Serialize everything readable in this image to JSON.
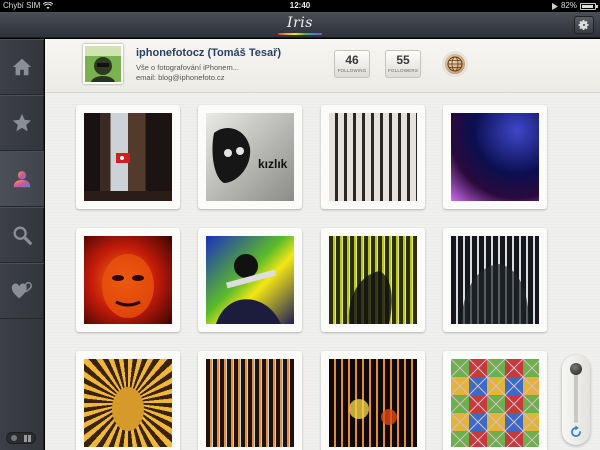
{
  "status_bar": {
    "carrier": "Chybí SIM",
    "time": "12:40",
    "battery_percent": "82%",
    "battery_level": 0.82
  },
  "navbar": {
    "app_title": "Iris",
    "settings_icon": "gear-icon"
  },
  "sidebar": {
    "items": [
      {
        "icon": "home-icon",
        "active": false
      },
      {
        "icon": "star-icon",
        "active": false
      },
      {
        "icon": "user-icon",
        "active": true
      },
      {
        "icon": "search-icon",
        "active": false
      },
      {
        "icon": "hearts-icon",
        "active": false
      }
    ]
  },
  "profile": {
    "name": "iphonefotocz (Tomáš Tesař)",
    "bio_line1": "Vše o fotografování iPhonem...",
    "bio_line2": "email: blog@iphonefoto.cz",
    "following_count": "46",
    "following_label": "FOLLOWING",
    "followers_count": "55",
    "followers_label": "FOLLOWERS"
  },
  "photos": [
    {
      "id": "p1"
    },
    {
      "id": "p2",
      "overlay_text": "kızlık"
    },
    {
      "id": "p3"
    },
    {
      "id": "p4"
    },
    {
      "id": "p5"
    },
    {
      "id": "p6"
    },
    {
      "id": "p7"
    },
    {
      "id": "p8"
    },
    {
      "id": "p9"
    },
    {
      "id": "p10"
    },
    {
      "id": "p11"
    },
    {
      "id": "p12"
    }
  ],
  "zoom_slider": {
    "level": 0.0,
    "refresh_icon": "refresh-icon"
  },
  "colors": {
    "name_text": "#2b3f66",
    "refresh_accent": "#2f7fd1"
  }
}
